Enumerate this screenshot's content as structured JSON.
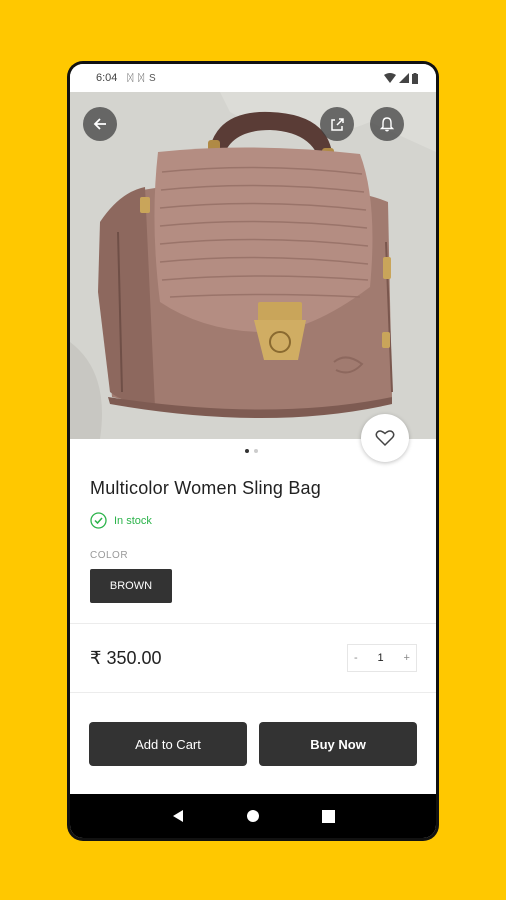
{
  "status_bar": {
    "time": "6:04",
    "notifications": "ᛞ ᛞ S"
  },
  "hero": {
    "back_icon": "back-arrow-icon",
    "share_icon": "share-icon",
    "bell_icon": "bell-icon",
    "favorite_icon": "heart-icon",
    "image_dots_count": 2,
    "active_dot": 0
  },
  "product": {
    "title": "Multicolor Women Sling Bag",
    "stock_status": "In stock",
    "color_label": "COLOR",
    "color_value": "BROWN",
    "price": "₹ 350.00",
    "quantity": "1",
    "qty_minus": "-",
    "qty_plus": "+"
  },
  "actions": {
    "add_to_cart": "Add to Cart",
    "buy_now": "Buy Now"
  },
  "colors": {
    "background": "#FFC800",
    "dark_button": "#333333",
    "stock_green": "#2BB34A"
  }
}
